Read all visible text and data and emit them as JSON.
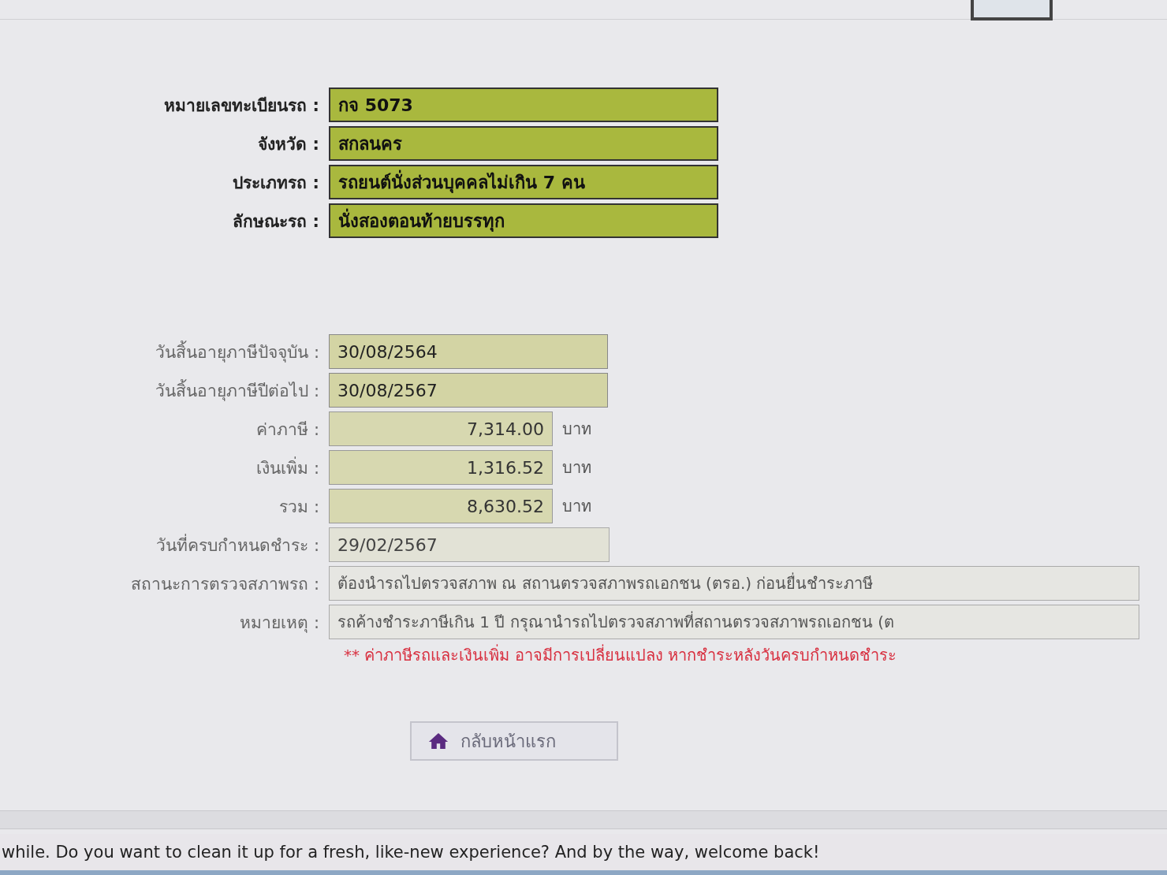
{
  "vehicle": [
    {
      "label": "หมายเลขทะเบียนรถ :",
      "value": "กจ 5073",
      "kind": "highlight"
    },
    {
      "label": "จังหวัด :",
      "value": "สกลนคร",
      "kind": "highlight"
    },
    {
      "label": "ประเภทรถ :",
      "value": "รถยนต์นั่งส่วนบุคคลไม่เกิน 7 คน",
      "kind": "highlight"
    },
    {
      "label": "ลักษณะรถ :",
      "value": "นั่งสองตอนท้ายบรรทุก",
      "kind": "highlight"
    }
  ],
  "tax": [
    {
      "label": "วันสิ้นอายุภาษีปัจจุบัน :",
      "value": "30/08/2564",
      "kind": "date"
    },
    {
      "label": "วันสิ้นอายุภาษีปีต่อไป :",
      "value": "30/08/2567",
      "kind": "date"
    },
    {
      "label": "ค่าภาษี :",
      "value": "7,314.00",
      "kind": "amount",
      "unit": "บาท"
    },
    {
      "label": "เงินเพิ่ม :",
      "value": "1,316.52",
      "kind": "amount",
      "unit": "บาท"
    },
    {
      "label": "รวม :",
      "value": "8,630.52",
      "kind": "amount",
      "unit": "บาท"
    },
    {
      "label": "วันที่ครบกำหนดชำระ :",
      "value": "29/02/2567",
      "kind": "plain"
    },
    {
      "label": "สถานะการตรวจสภาพรถ :",
      "value": "ต้องนำรถไปตรวจสภาพ ณ สถานตรวจสภาพรถเอกชน (ตรอ.) ก่อนยื่นชำระภาษี",
      "kind": "wide"
    },
    {
      "label": "หมายเหตุ :",
      "value": "รถค้างชำระภาษีเกิน 1 ปี กรุณานำรถไปตรวจสภาพที่สถานตรวจสภาพรถเอกชน (ต",
      "kind": "wide"
    }
  ],
  "warning": "** ค่าภาษีรถและเงินเพิ่ม อาจมีการเปลี่ยนแปลง หากชำระหลังวันครบกำหนดชำระ",
  "home_button": {
    "label": "กลับหน้าแรก"
  },
  "notification_bar": {
    "text": "while. Do you want to clean it up for a fresh, like-new experience? And by the way, welcome back!"
  }
}
